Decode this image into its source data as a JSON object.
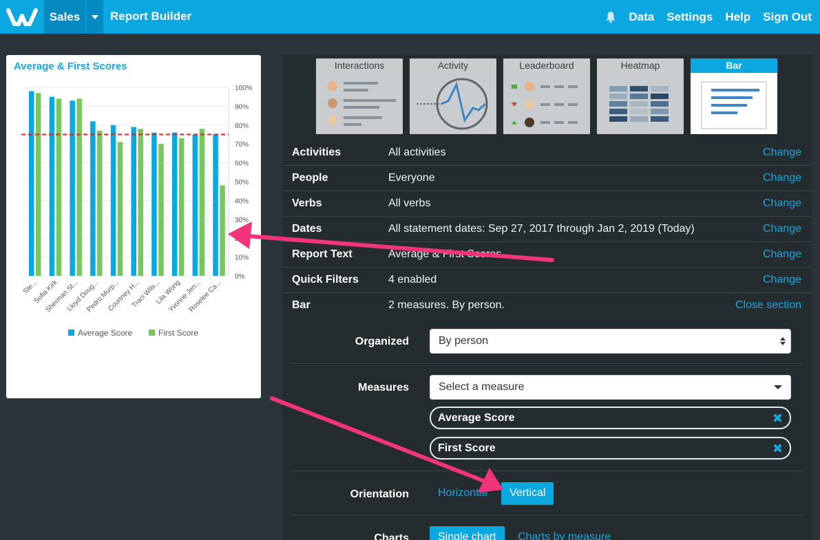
{
  "nav": {
    "logo": "W",
    "app": "Sales",
    "page": "Report Builder",
    "links": [
      "Data",
      "Settings",
      "Help",
      "Sign Out"
    ]
  },
  "card": {
    "title": "Average & First Scores"
  },
  "chart_data": {
    "type": "bar",
    "categories": [
      "Ste...",
      "Sofia Kirk",
      "Sherman St...",
      "Lloyd Doug...",
      "Pedro Murp...",
      "Courtney H...",
      "Traci Wils...",
      "Lila Wong",
      "Yvonne Jen...",
      "Roselee Ca..."
    ],
    "series": [
      {
        "name": "Average Score",
        "color": "#0aa7e0",
        "values": [
          98,
          95,
          93,
          82,
          80,
          79,
          76,
          76,
          75,
          75
        ]
      },
      {
        "name": "First Score",
        "color": "#7ac461",
        "values": [
          97,
          94,
          94,
          77,
          71,
          78,
          70,
          73,
          78,
          48
        ]
      }
    ],
    "ylim": [
      0,
      100
    ],
    "yticks": [
      "0%",
      "10%",
      "20%",
      "30%",
      "40%",
      "50%",
      "60%",
      "70%",
      "80%",
      "90%",
      "100%"
    ],
    "reference_line": 75,
    "legend": "bottom",
    "grid": true
  },
  "tiles": [
    {
      "label": "Interactions",
      "active": false
    },
    {
      "label": "Activity",
      "active": false
    },
    {
      "label": "Leaderboard",
      "active": false
    },
    {
      "label": "Heatmap",
      "active": false
    },
    {
      "label": "Bar",
      "active": true
    }
  ],
  "rows": [
    {
      "label": "Activities",
      "value": "All activities",
      "action": "Change"
    },
    {
      "label": "People",
      "value": "Everyone",
      "action": "Change"
    },
    {
      "label": "Verbs",
      "value": "All verbs",
      "action": "Change"
    },
    {
      "label": "Dates",
      "value": "All statement dates: Sep 27, 2017 through Jan 2, 2019 (Today)",
      "action": "Change"
    },
    {
      "label": "Report Text",
      "value": "Average & First Scores",
      "action": "Change"
    },
    {
      "label": "Quick Filters",
      "value": "4 enabled",
      "action": "Change"
    },
    {
      "label": "Bar",
      "value": "2 measures. By person.",
      "action": "Close section"
    }
  ],
  "bar_section": {
    "organized_label": "Organized",
    "organized_value": "By person",
    "measures_label": "Measures",
    "measures_placeholder": "Select a measure",
    "measures": [
      "Average Score",
      "First Score"
    ],
    "remove_glyph": "✖",
    "orientation_label": "Orientation",
    "orientation_options": [
      "Horizontal",
      "Vertical"
    ],
    "orientation_selected": "Vertical",
    "charts_label": "Charts",
    "charts_options": [
      "Single chart",
      "Charts by measure"
    ],
    "charts_selected": "Single chart"
  }
}
